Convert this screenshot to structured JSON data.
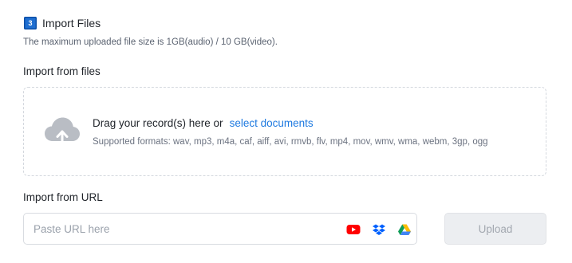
{
  "section": {
    "step_number": "3",
    "title": "Import Files",
    "size_hint": "The maximum uploaded file size is 1GB(audio) / 10 GB(video)."
  },
  "import_files": {
    "label": "Import from files",
    "drag_text": "Drag your record(s) here or",
    "select_link": "select documents",
    "formats": "Supported formats: wav, mp3, m4a, caf, aiff, avi, rmvb, flv, mp4, mov, wmv, wma, webm, 3gp, ogg"
  },
  "import_url": {
    "label": "Import from URL",
    "placeholder": "Paste URL here",
    "value": "",
    "source_icons": [
      "youtube-icon",
      "dropbox-icon",
      "google-drive-icon"
    ],
    "upload_label": "Upload"
  },
  "colors": {
    "accent": "#1f7ae0",
    "badge": "#1f6fd1",
    "youtube": "#ff0000",
    "dropbox": "#0061fe",
    "disabled_button_bg": "#eceef1",
    "disabled_button_text": "#a3a8b0"
  }
}
